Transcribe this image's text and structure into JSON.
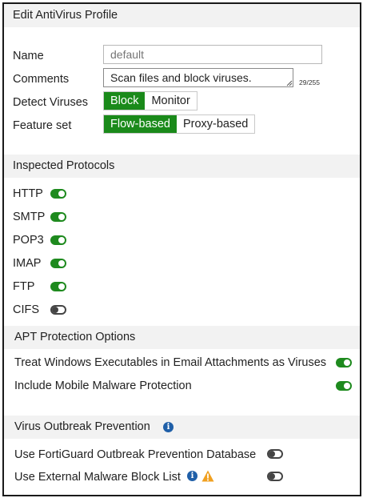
{
  "title": "Edit AntiVirus Profile",
  "form": {
    "name_label": "Name",
    "name_placeholder": "default",
    "comments_label": "Comments",
    "comments_value": "Scan files and block viruses.",
    "comments_counter": "29/255",
    "detect_label": "Detect Viruses",
    "detect_options": [
      "Block",
      "Monitor"
    ],
    "detect_selected": "Block",
    "feature_label": "Feature set",
    "feature_options": [
      "Flow-based",
      "Proxy-based"
    ],
    "feature_selected": "Flow-based"
  },
  "inspected": {
    "header": "Inspected Protocols",
    "protocols": [
      {
        "label": "HTTP",
        "enabled": true
      },
      {
        "label": "SMTP",
        "enabled": true
      },
      {
        "label": "POP3",
        "enabled": true
      },
      {
        "label": "IMAP",
        "enabled": true
      },
      {
        "label": "FTP",
        "enabled": true
      },
      {
        "label": "CIFS",
        "enabled": false
      }
    ]
  },
  "apt": {
    "header": "APT Protection Options",
    "options": [
      {
        "label": "Treat Windows Executables in Email Attachments as Viruses",
        "enabled": true
      },
      {
        "label": "Include Mobile Malware Protection",
        "enabled": true
      }
    ]
  },
  "outbreak": {
    "header": "Virus Outbreak Prevention",
    "options": [
      {
        "label": "Use FortiGuard Outbreak Prevention Database",
        "enabled": false
      },
      {
        "label": "Use External Malware Block List",
        "enabled": false
      }
    ]
  },
  "colors": {
    "accent_green": "#1a8a1a",
    "info_blue": "#1f5fa8",
    "warning_orange": "#f0a020"
  },
  "icons": {
    "info": "info-circle-icon",
    "warning": "warning-triangle-icon"
  }
}
